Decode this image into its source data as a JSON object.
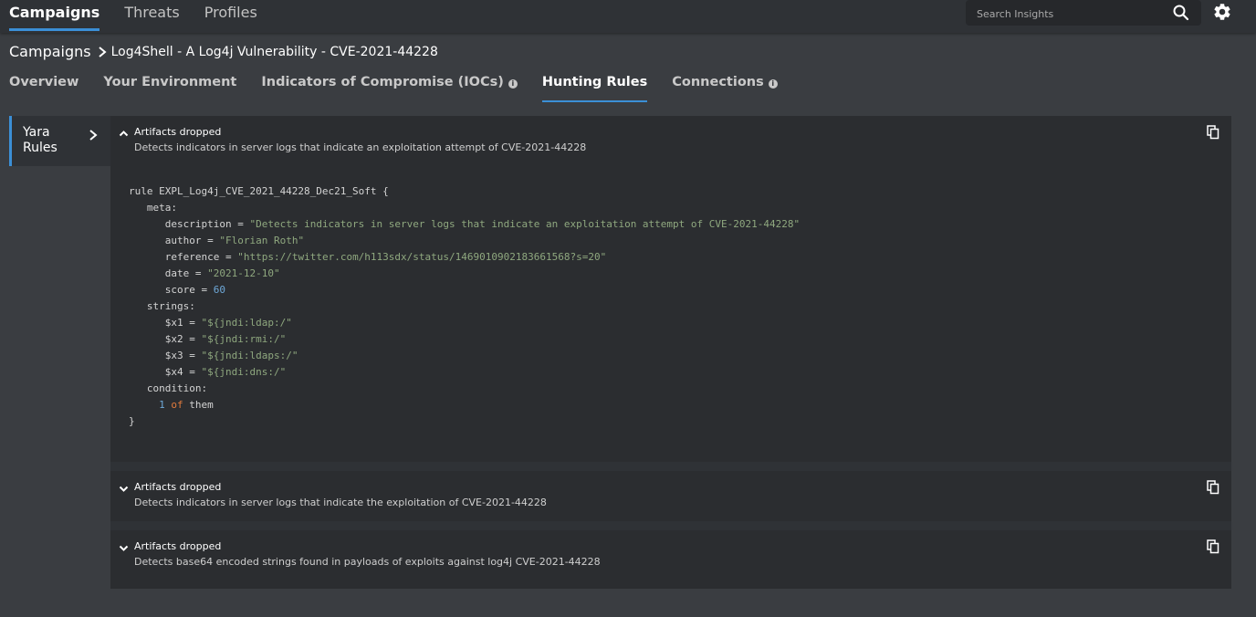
{
  "topnav": {
    "items": [
      "Campaigns",
      "Threats",
      "Profiles"
    ],
    "search_placeholder": "Search Insights"
  },
  "breadcrumb": {
    "root": "Campaigns",
    "page": "Log4Shell - A Log4j Vulnerability - CVE-2021-44228"
  },
  "tabs": [
    "Overview",
    "Your Environment",
    "Indicators of Compromise (IOCs)",
    "Hunting Rules",
    "Connections"
  ],
  "sidenav": {
    "label": "Yara Rules"
  },
  "rules": [
    {
      "title": "Artifacts dropped",
      "description": "Detects indicators in server logs that indicate an exploitation attempt of CVE-2021-44228",
      "expanded": true
    },
    {
      "title": "Artifacts dropped",
      "description": "Detects indicators in server logs that indicate the exploitation of CVE-2021-44228",
      "expanded": false
    },
    {
      "title": "Artifacts dropped",
      "description": "Detects base64 encoded strings found in payloads of exploits against log4j CVE-2021-44228",
      "expanded": false
    }
  ],
  "code": {
    "rule_line": "rule EXPL_Log4j_CVE_2021_44228_Dec21_Soft {",
    "meta": "meta:",
    "description_key": "description = ",
    "description_val": "\"Detects indicators in server logs that indicate an exploitation attempt of CVE-2021-44228\"",
    "author_key": "author = ",
    "author_val": "\"Florian Roth\"",
    "reference_key": "reference = ",
    "reference_val": "\"https://twitter.com/h113sdx/status/1469010902183661568?s=20\"",
    "date_key": "date = ",
    "date_val": "\"2021-12-10\"",
    "score_key": "score = ",
    "score_val": "60",
    "strings": "strings:",
    "x1_key": "$x1 = ",
    "x1_val": "\"${jndi:ldap:/\"",
    "x2_key": "$x2 = ",
    "x2_val": "\"${jndi:rmi:/\"",
    "x3_key": "$x3 = ",
    "x3_val": "\"${jndi:ldaps:/\"",
    "x4_key": "$x4 = ",
    "x4_val": "\"${jndi:dns:/\"",
    "condition": "condition:",
    "cond_num": "1",
    "cond_of": "of",
    "cond_them": "them",
    "close": "}"
  },
  "colors": {
    "accent": "#3b8fd6",
    "string": "#8fa87f",
    "number": "#6ea8d8",
    "keyword": "#e07a3d"
  },
  "icons": [
    "search-icon",
    "gear-icon",
    "chevron-right-icon",
    "chevron-up-icon",
    "chevron-down-icon",
    "copy-icon",
    "info-icon"
  ]
}
